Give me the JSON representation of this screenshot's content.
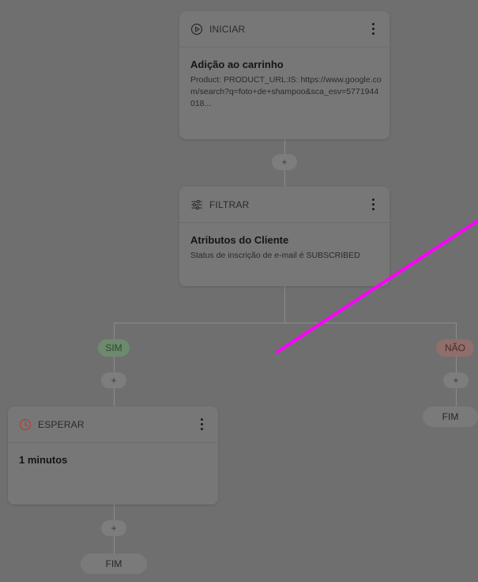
{
  "start_node": {
    "type_label": "INICIAR",
    "title": "Adição ao carrinho",
    "description": "Product: PRODUCT_URL:IS: https://www.google.com/search?q=foto+de+shampoo&sca_esv=5771944018..."
  },
  "filter_node": {
    "type_label": "FILTRAR",
    "title": "Atributos do Cliente",
    "description": "Status de inscrição de e-mail é SUBSCRIBED"
  },
  "branches": {
    "yes_label": "SIM",
    "no_label": "NÃO"
  },
  "wait_node": {
    "type_label": "ESPERAR",
    "title": "1 minutos"
  },
  "add_step_label": "+",
  "end_label": "FIM",
  "colors": {
    "overlay": "#6f6f6f",
    "card": "#777777",
    "annotation_stroke": "#ff00ff",
    "yes_badge": "#6e8a6e",
    "no_badge": "#8f6f6b",
    "wait_icon": "#c0392b"
  },
  "icons": {
    "start": "play-circle-icon",
    "filter": "sliders-icon",
    "wait": "clock-icon",
    "menu": "kebab-menu-icon"
  }
}
